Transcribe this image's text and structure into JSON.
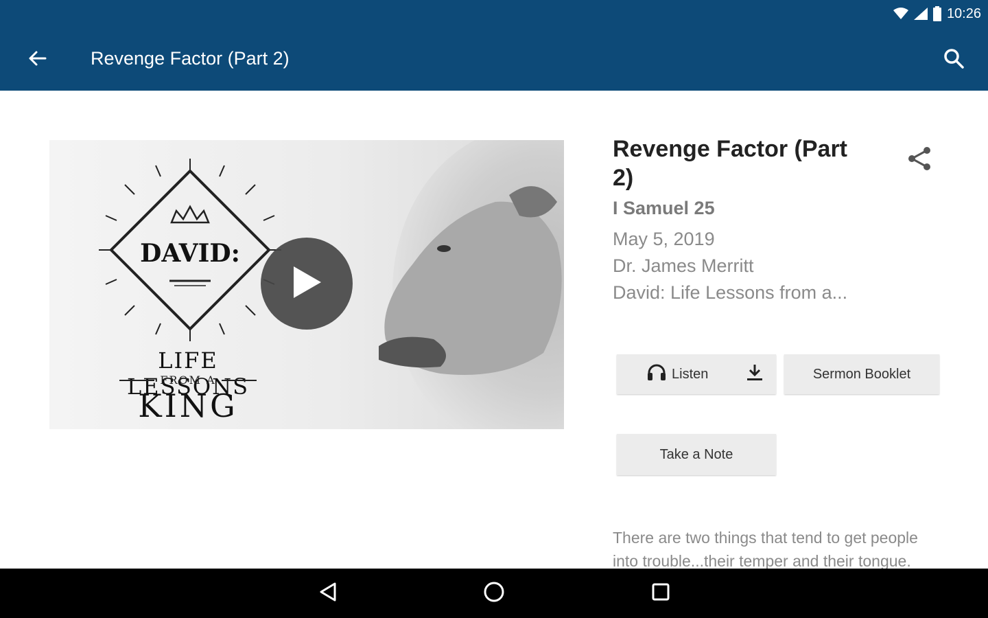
{
  "status_bar": {
    "time": "10:26"
  },
  "app_bar": {
    "title": "Revenge Factor (Part 2)"
  },
  "artwork": {
    "series_word": "DAVID:",
    "line1": "LIFE LESSONS",
    "line2": "FROM A",
    "line3": "KING"
  },
  "sermon": {
    "title": "Revenge Factor (Part 2)",
    "scripture": "I Samuel 25",
    "date": "May 5, 2019",
    "speaker": "Dr. James Merritt",
    "series": "David: Life Lessons from a..."
  },
  "actions": {
    "listen_label": "Listen",
    "booklet_label": "Sermon Booklet",
    "note_label": "Take a Note"
  },
  "description": "There are two things that tend to get people into trouble...their temper and their tongue.",
  "colors": {
    "app_bar": "#0d4a78",
    "nav_bar": "#000000",
    "button_bg": "#ececec"
  }
}
